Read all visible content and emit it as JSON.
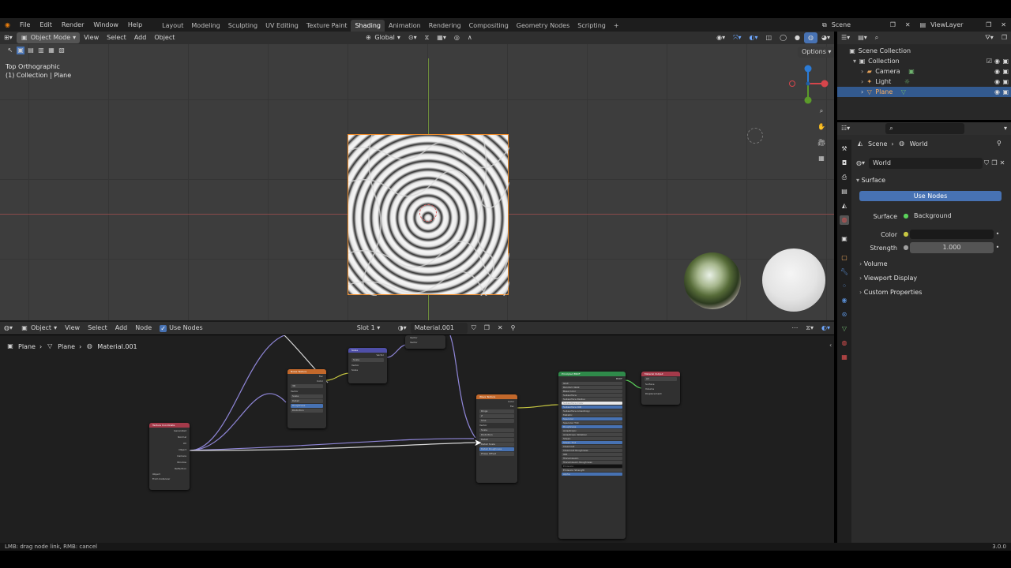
{
  "topbar": {
    "menus": [
      "File",
      "Edit",
      "Render",
      "Window",
      "Help"
    ],
    "workspaces": [
      "Layout",
      "Modeling",
      "Sculpting",
      "UV Editing",
      "Texture Paint",
      "Shading",
      "Animation",
      "Rendering",
      "Compositing",
      "Geometry Nodes",
      "Scripting"
    ],
    "active_workspace": "Shading",
    "add_tab": "+",
    "scene": "Scene",
    "view_layer": "ViewLayer"
  },
  "viewport_header": {
    "mode": "Object Mode",
    "menus": [
      "View",
      "Select",
      "Add",
      "Object"
    ],
    "transform": "Global",
    "options": "Options"
  },
  "viewport": {
    "view_name": "Top Orthographic",
    "collection_info": "(1) Collection | Plane"
  },
  "node_header": {
    "editor_type": "Object",
    "menus": [
      "View",
      "Select",
      "Add",
      "Node"
    ],
    "use_nodes": "Use Nodes",
    "slot": "Slot 1",
    "material": "Material.001"
  },
  "breadcrumb": [
    "Plane",
    "Plane",
    "Material.001"
  ],
  "nodes": {
    "texture_coordinate": {
      "title": "Texture Coordinate",
      "outputs": [
        "Generated",
        "Normal",
        "UV",
        "Object",
        "Camera",
        "Window",
        "Reflection"
      ],
      "object_label": "Object",
      "from_instancer": "From Instancer"
    },
    "noise_texture": {
      "title": "Noise Texture",
      "inputs": [
        "Vector",
        "Scale",
        "Detail",
        "Roughness",
        "Distortion"
      ],
      "outputs": [
        "Fac",
        "Color"
      ],
      "dim": "3D"
    },
    "scale": {
      "title": "Scale",
      "fields": [
        "Scale",
        "Vector",
        "Scale"
      ],
      "output": "Vector"
    },
    "vector_top": {
      "fields": [
        "Vector",
        "Vector"
      ]
    },
    "wave_texture": {
      "title": "Wave Texture",
      "outputs": [
        "Color",
        "Fac"
      ],
      "fields": [
        "Rings",
        "Z",
        "Sine",
        "Vector",
        "Scale",
        "Distortion",
        "Detail",
        "Detail Scale",
        "Detail Roughness",
        "Phase Offset"
      ]
    },
    "principled": {
      "title": "Principled BSDF",
      "output": "BSDF",
      "fields": [
        "GGX",
        "Random Walk",
        "Base Color",
        "Subsurface",
        "Subsurface Radius",
        "Subsurface Color",
        "Subsurface IOR",
        "Subsurface Anisotropy",
        "Metallic",
        "Specular",
        "Specular Tint",
        "Roughness",
        "Anisotropic",
        "Anisotropic Rotation",
        "Sheen",
        "Sheen Tint",
        "Clearcoat",
        "Clearcoat Roughness",
        "IOR",
        "Transmission",
        "Transmission Roughness",
        "Emission",
        "Emission Strength",
        "Alpha"
      ]
    },
    "material_output": {
      "title": "Material Output",
      "target": "All",
      "inputs": [
        "Surface",
        "Volume",
        "Displacement"
      ]
    }
  },
  "outliner": {
    "root": "Scene Collection",
    "items": [
      {
        "name": "Collection",
        "selected": false
      },
      {
        "name": "Camera",
        "selected": false
      },
      {
        "name": "Light",
        "selected": false
      },
      {
        "name": "Plane",
        "selected": true
      }
    ]
  },
  "properties": {
    "breadcrumb_scene": "Scene",
    "breadcrumb_world": "World",
    "world_name": "World",
    "surface_section": "Surface",
    "use_nodes_button": "Use Nodes",
    "surface_label": "Surface",
    "surface_value": "Background",
    "color_label": "Color",
    "strength_label": "Strength",
    "strength_value": "1.000",
    "sections": [
      "Volume",
      "Viewport Display",
      "Custom Properties"
    ]
  },
  "status": {
    "hint": "LMB: drag node link, RMB: cancel",
    "version": "3.0.0"
  },
  "colors": {
    "accent_blue": "#4772b3",
    "selection_orange": "#f08d2b",
    "header_gray": "#2f2f2f"
  }
}
